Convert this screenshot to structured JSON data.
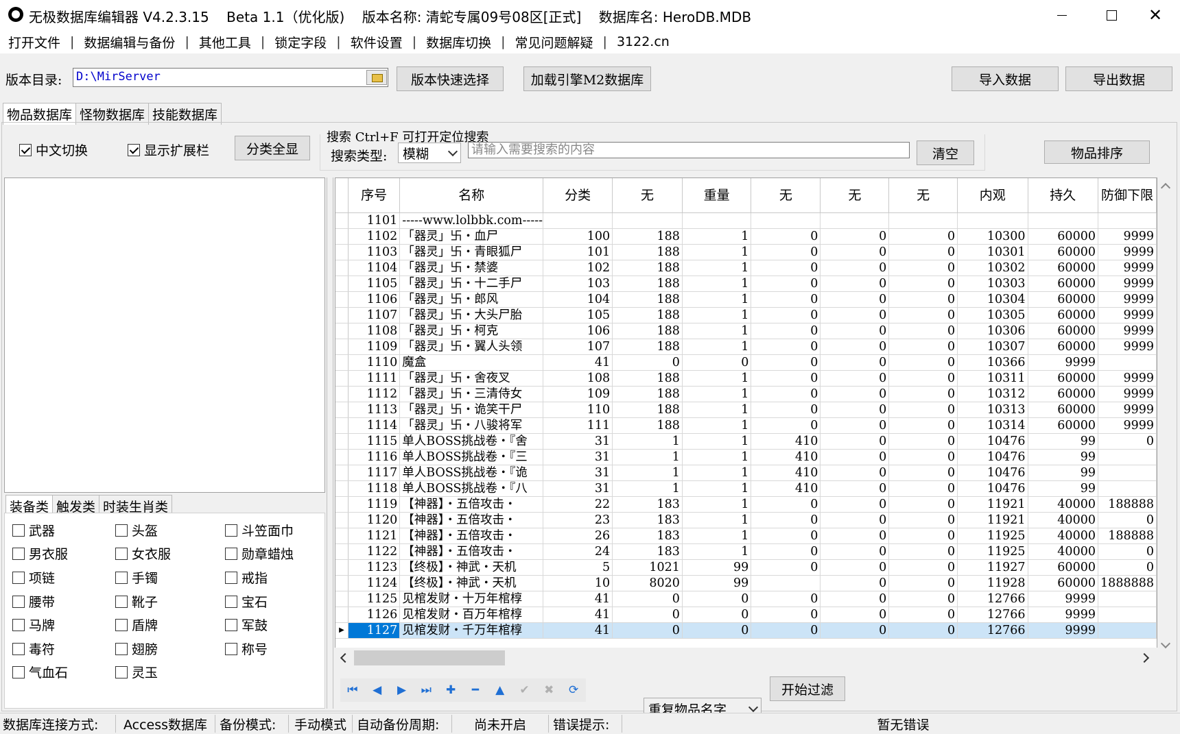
{
  "titlebar": {
    "app_title": "无极数据库编辑器 V4.2.3.15",
    "version": "Beta 1.1（优化版)",
    "version_name": "版本名称: 清蛇专属09号08区[正式]",
    "db_name": "数据库名: HeroDB.MDB"
  },
  "menu": [
    "打开文件",
    "数据编辑与备份",
    "其他工具",
    "锁定字段",
    "软件设置",
    "数据库切换",
    "常见问题解疑",
    "3122.cn"
  ],
  "toolbar": {
    "dir_label": "版本目录:",
    "dir_value": "D:\\MirServer",
    "quick_select": "版本快速选择",
    "load_m2": "加载引擎M2数据库",
    "import": "导入数据",
    "export": "导出数据"
  },
  "tabs": [
    "物品数据库",
    "怪物数据库",
    "技能数据库"
  ],
  "options": {
    "chinese_switch": "中文切换",
    "show_ext": "显示扩展栏",
    "show_all_cat": "分类全显"
  },
  "search": {
    "title": "搜索  Ctrl+F 可打开定位搜索",
    "type_label": "搜索类型:",
    "type_value": "模糊",
    "placeholder": "请输入需要搜索的内容",
    "clear": "清空",
    "sort": "物品排序"
  },
  "cat_tabs": [
    "装备类",
    "触发类",
    "时装生肖类"
  ],
  "categories": [
    "武器",
    "头盔",
    "斗笠面巾",
    "男衣服",
    "女衣服",
    "勋章蜡烛",
    "项链",
    "手镯",
    "戒指",
    "腰带",
    "靴子",
    "宝石",
    "马牌",
    "盾牌",
    "军鼓",
    "毒符",
    "翅膀",
    "称号",
    "气血石",
    "灵玉"
  ],
  "grid": {
    "columns": [
      "序号",
      "名称",
      "分类",
      "无",
      "重量",
      "无",
      "无",
      "无",
      "内观",
      "持久",
      "防御下限"
    ],
    "rows": [
      [
        "1101",
        "-----www.lolbbk.com-----",
        "",
        "",
        "",
        "",
        "",
        "",
        "",
        "",
        ""
      ],
      [
        "1102",
        "「器灵」卐・血尸",
        "100",
        "188",
        "1",
        "0",
        "0",
        "0",
        "10300",
        "60000",
        "9999"
      ],
      [
        "1103",
        "「器灵」卐・青眼狐尸",
        "101",
        "188",
        "1",
        "0",
        "0",
        "0",
        "10301",
        "60000",
        "9999"
      ],
      [
        "1104",
        "「器灵」卐・禁婆",
        "102",
        "188",
        "1",
        "0",
        "0",
        "0",
        "10302",
        "60000",
        "9999"
      ],
      [
        "1105",
        "「器灵」卐・十二手尸",
        "103",
        "188",
        "1",
        "0",
        "0",
        "0",
        "10303",
        "60000",
        "9999"
      ],
      [
        "1106",
        "「器灵」卐・郎风",
        "104",
        "188",
        "1",
        "0",
        "0",
        "0",
        "10304",
        "60000",
        "9999"
      ],
      [
        "1107",
        "「器灵」卐・大头尸胎",
        "105",
        "188",
        "1",
        "0",
        "0",
        "0",
        "10305",
        "60000",
        "9999"
      ],
      [
        "1108",
        "「器灵」卐・柯克",
        "106",
        "188",
        "1",
        "0",
        "0",
        "0",
        "10306",
        "60000",
        "9999"
      ],
      [
        "1109",
        "「器灵」卐・翼人头领",
        "107",
        "188",
        "1",
        "0",
        "0",
        "0",
        "10307",
        "60000",
        "9999"
      ],
      [
        "1110",
        "魔盒",
        "41",
        "0",
        "0",
        "0",
        "0",
        "0",
        "10366",
        "9999",
        ""
      ],
      [
        "1111",
        "「器灵」卐・舍夜叉",
        "108",
        "188",
        "1",
        "0",
        "0",
        "0",
        "10311",
        "60000",
        "9999"
      ],
      [
        "1112",
        "「器灵」卐・三清侍女",
        "109",
        "188",
        "1",
        "0",
        "0",
        "0",
        "10312",
        "60000",
        "9999"
      ],
      [
        "1113",
        "「器灵」卐・诡笑干尸",
        "110",
        "188",
        "1",
        "0",
        "0",
        "0",
        "10313",
        "60000",
        "9999"
      ],
      [
        "1114",
        "「器灵」卐・八骏将军",
        "111",
        "188",
        "1",
        "0",
        "0",
        "0",
        "10314",
        "60000",
        "9999"
      ],
      [
        "1115",
        "单人BOSS挑战卷・『舍",
        "31",
        "1",
        "1",
        "410",
        "0",
        "0",
        "10476",
        "99",
        "0"
      ],
      [
        "1116",
        "单人BOSS挑战卷・『三",
        "31",
        "1",
        "1",
        "410",
        "0",
        "0",
        "10476",
        "99",
        ""
      ],
      [
        "1117",
        "单人BOSS挑战卷・『诡",
        "31",
        "1",
        "1",
        "410",
        "0",
        "0",
        "10476",
        "99",
        ""
      ],
      [
        "1118",
        "单人BOSS挑战卷・『八",
        "31",
        "1",
        "1",
        "410",
        "0",
        "0",
        "10476",
        "99",
        ""
      ],
      [
        "1119",
        "【神器】・五倍攻击・",
        "22",
        "183",
        "1",
        "0",
        "0",
        "0",
        "11921",
        "40000",
        "188888"
      ],
      [
        "1120",
        "【神器】・五倍攻击・",
        "23",
        "183",
        "1",
        "0",
        "0",
        "0",
        "11921",
        "40000",
        "0"
      ],
      [
        "1121",
        "【神器】・五倍攻击・",
        "26",
        "183",
        "1",
        "0",
        "0",
        "0",
        "11925",
        "40000",
        "188888"
      ],
      [
        "1122",
        "【神器】・五倍攻击・",
        "24",
        "183",
        "1",
        "0",
        "0",
        "0",
        "11925",
        "40000",
        "0"
      ],
      [
        "1123",
        "【终极】・神武・天机",
        "5",
        "1021",
        "99",
        "0",
        "0",
        "0",
        "11927",
        "60000",
        "0"
      ],
      [
        "1124",
        "【终极】・神武・天机",
        "10",
        "8020",
        "99",
        "",
        "0",
        "0",
        "11928",
        "60000",
        "1888888"
      ],
      [
        "1125",
        "见棺发财・十万年棺椁",
        "41",
        "0",
        "0",
        "0",
        "0",
        "0",
        "12766",
        "9999",
        ""
      ],
      [
        "1126",
        "见棺发财・百万年棺椁",
        "41",
        "0",
        "0",
        "0",
        "0",
        "0",
        "12766",
        "9999",
        ""
      ],
      [
        "1127",
        "见棺发财・千万年棺椁",
        "41",
        "0",
        "0",
        "0",
        "0",
        "0",
        "12766",
        "9999",
        ""
      ]
    ]
  },
  "bottom": {
    "dup_select": "重复物品名字",
    "filter": "开始过滤"
  },
  "status": {
    "conn_label": "数据库连接方式:",
    "conn_value": "Access数据库",
    "backup_label": "备份模式:",
    "backup_value": "手动模式",
    "auto_label": "自动备份周期:",
    "auto_value": "尚未开启",
    "err_label": "错误提示:",
    "err_value": "暂无错误"
  }
}
